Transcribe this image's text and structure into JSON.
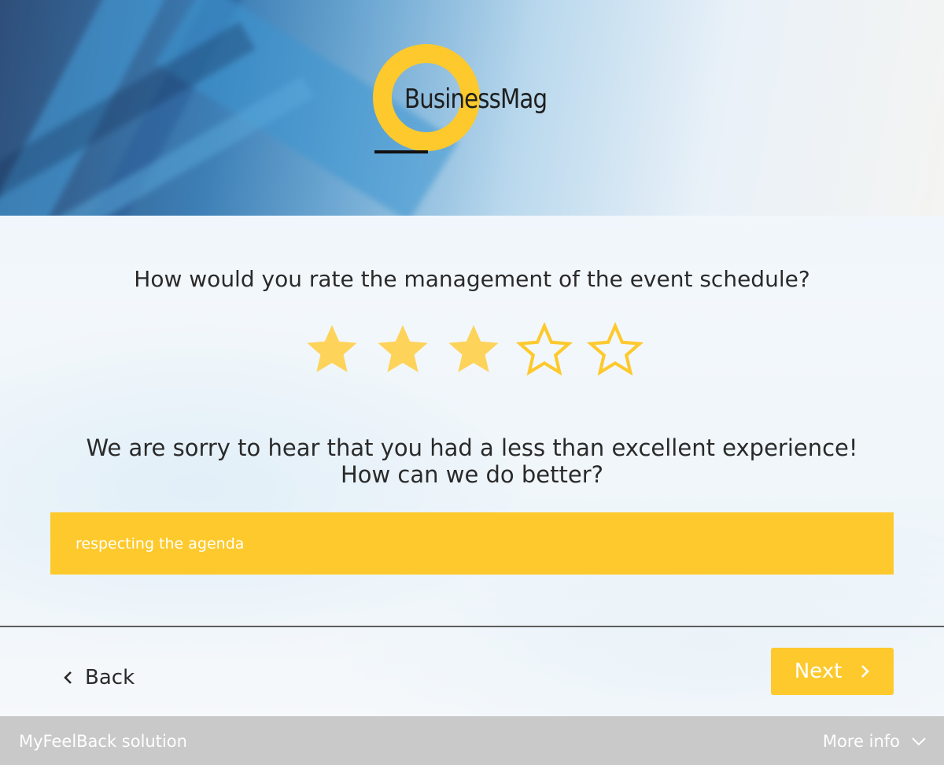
{
  "brand": {
    "logo_text": "BusinessMag",
    "accent": "#fdc92c"
  },
  "survey": {
    "question": "How would you rate the management of the event schedule?",
    "rating": {
      "value": 3,
      "max": 5
    },
    "followup_line1": "We are sorry to hear that you had a less than excellent experience!",
    "followup_line2": "How can we do better?",
    "answer_value": "respecting the agenda"
  },
  "nav": {
    "back_label": "Back",
    "next_label": "Next"
  },
  "footer": {
    "left_text": "MyFeelBack solution",
    "right_text": "More info"
  }
}
